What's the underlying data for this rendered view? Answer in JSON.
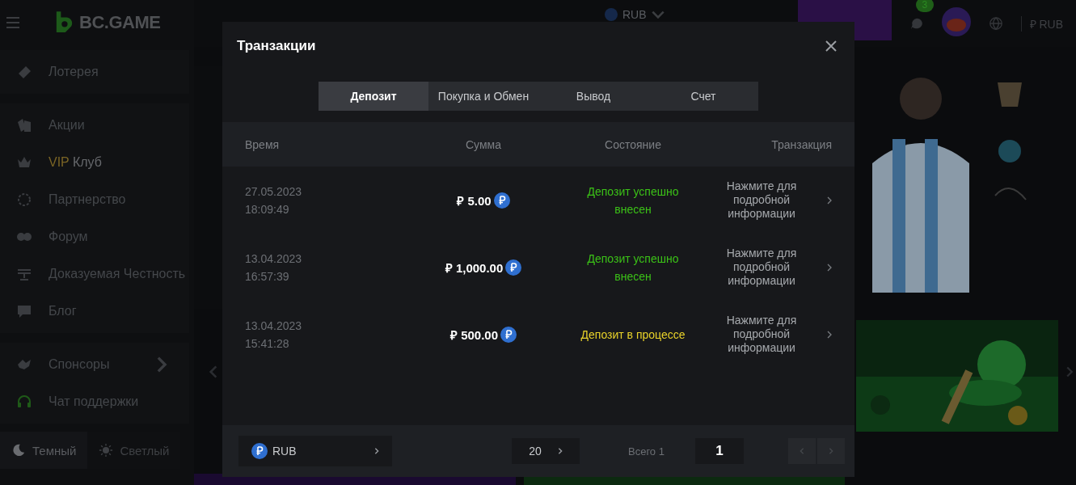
{
  "sidebar": {
    "logo": "BC.GAME",
    "groups": [
      [
        {
          "label": "Лотерея"
        }
      ],
      [
        {
          "label": "Акции"
        },
        {
          "prefix": "VIP",
          "label": "Клуб"
        },
        {
          "label": "Партнерство"
        },
        {
          "label": "Форум"
        },
        {
          "label": "Доказуемая Честность"
        },
        {
          "label": "Блог"
        }
      ],
      [
        {
          "label": "Спонсоры",
          "expandable": true
        },
        {
          "label": "Чат поддержки",
          "expandable": false
        }
      ]
    ],
    "themes": [
      {
        "label": "Темный",
        "selected": true
      },
      {
        "label": "Светлый",
        "selected": false
      }
    ]
  },
  "header": {
    "currency": "RUB",
    "badge": "3",
    "right_currency": "₽ RUB"
  },
  "modal": {
    "title": "Транзакции",
    "tabs": [
      {
        "label": "Депозит",
        "selected": true
      },
      {
        "label": "Покупка и Обмен",
        "selected": false
      },
      {
        "label": "Вывод",
        "selected": false
      },
      {
        "label": "Счет",
        "selected": false
      }
    ],
    "columns": [
      "Время",
      "Сумма",
      "Состояние",
      "Транзакция"
    ],
    "rows": [
      {
        "date": "27.05.2023",
        "time": "18:09:49",
        "amount": "₽ 5.00",
        "status": "Депозит успешно внесен",
        "kind": "success",
        "details": "Нажмите для подробной информации"
      },
      {
        "date": "13.04.2023",
        "time": "16:57:39",
        "amount": "₽ 1,000.00",
        "status": "Депозит успешно внесен",
        "kind": "success",
        "details": "Нажмите для подробной информации"
      },
      {
        "date": "13.04.2023",
        "time": "15:41:28",
        "amount": "₽ 500.00",
        "status": "Депозит в процессе",
        "kind": "pending",
        "details": "Нажмите для подробной информации"
      }
    ],
    "footer": {
      "currency": "RUB",
      "page_size": "20",
      "total": "Всего 1",
      "page": "1"
    }
  }
}
